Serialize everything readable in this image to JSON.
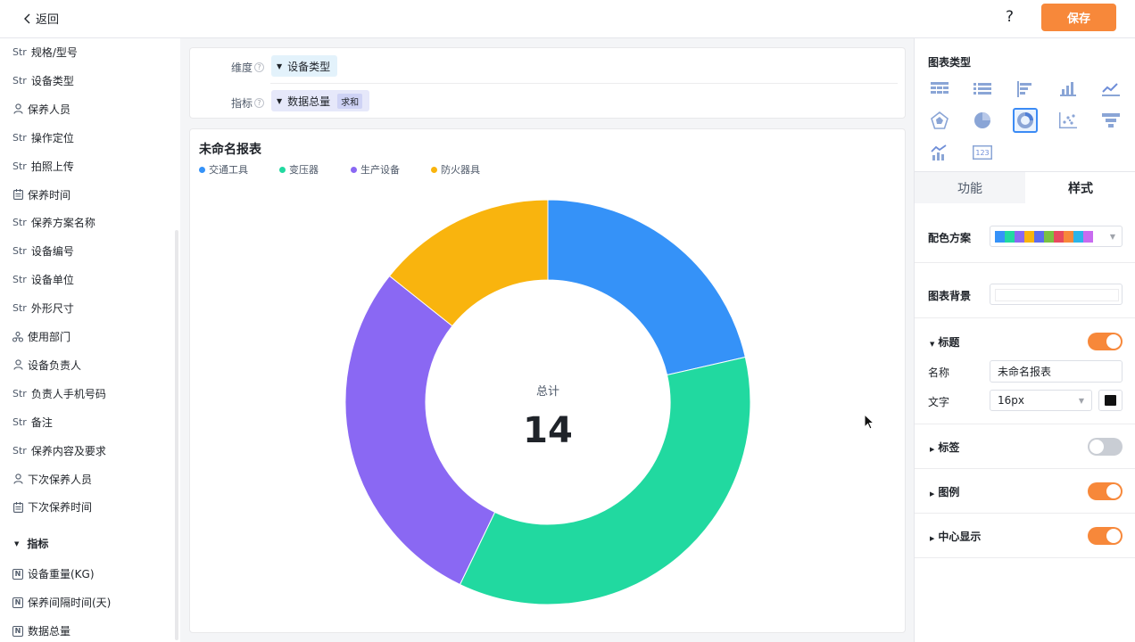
{
  "topbar": {
    "back_label": "返回",
    "help_label": "?",
    "save_label": "保存"
  },
  "fields": {
    "dimensions": [
      {
        "type": "Str",
        "label": "规格/型号"
      },
      {
        "type": "Str",
        "label": "设备类型"
      },
      {
        "type": "person",
        "label": "保养人员"
      },
      {
        "type": "Str",
        "label": "操作定位"
      },
      {
        "type": "Str",
        "label": "拍照上传"
      },
      {
        "type": "date",
        "label": "保养时间"
      },
      {
        "type": "Str",
        "label": "保养方案名称"
      },
      {
        "type": "Str",
        "label": "设备编号"
      },
      {
        "type": "Str",
        "label": "设备单位"
      },
      {
        "type": "Str",
        "label": "外形尺寸"
      },
      {
        "type": "dept",
        "label": "使用部门"
      },
      {
        "type": "person",
        "label": "设备负责人"
      },
      {
        "type": "Str",
        "label": "负责人手机号码"
      },
      {
        "type": "Str",
        "label": "备注"
      },
      {
        "type": "Str",
        "label": "保养内容及要求"
      },
      {
        "type": "person",
        "label": "下次保养人员"
      },
      {
        "type": "date",
        "label": "下次保养时间"
      }
    ],
    "metrics_section": "指标",
    "metrics": [
      {
        "type": "N",
        "label": "设备重量(KG)"
      },
      {
        "type": "N",
        "label": "保养间隔时间(天)"
      },
      {
        "type": "N",
        "label": "数据总量"
      }
    ]
  },
  "config": {
    "dimension_label": "维度",
    "dimension_value": "设备类型",
    "metric_label": "指标",
    "metric_value": "数据总量",
    "metric_agg": "求和"
  },
  "chart_data": {
    "type": "pie",
    "title": "未命名报表",
    "categories": [
      "交通工具",
      "变压器",
      "生产设备",
      "防火器具"
    ],
    "values": [
      3,
      5,
      4,
      2
    ],
    "colors": [
      "#3592f8",
      "#21d9a0",
      "#8a68f3",
      "#f9b40e"
    ],
    "center_label": "总计",
    "center_value": "14",
    "donut": true,
    "legend_position": "top-left"
  },
  "panel": {
    "chart_type_title": "图表类型",
    "tab_function": "功能",
    "tab_style": "样式",
    "palette_label": "配色方案",
    "palette_colors": [
      "#3592f8",
      "#21d9a0",
      "#8a68f3",
      "#f9b40e",
      "#5b6cf0",
      "#7ac143",
      "#e84a5f",
      "#f7883a",
      "#2bb4e8",
      "#c86bf0"
    ],
    "bg_label": "图表背景",
    "title_section": "标题",
    "name_label": "名称",
    "name_value": "未命名报表",
    "text_label": "文字",
    "font_size_value": "16px",
    "label_section": "标签",
    "legend_section": "图例",
    "center_section": "中心显示"
  }
}
